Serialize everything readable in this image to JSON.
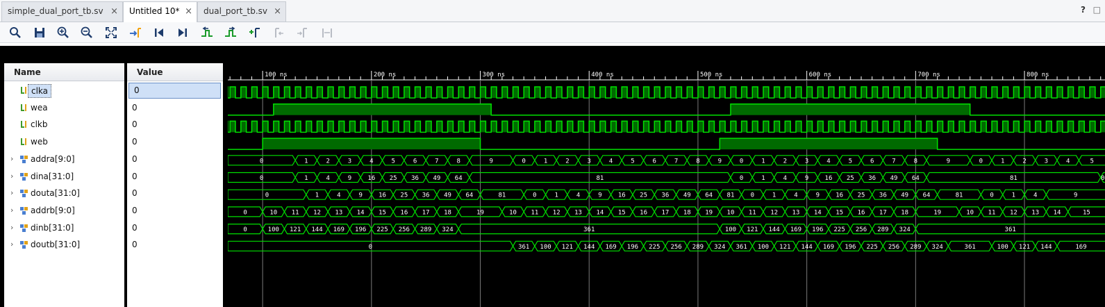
{
  "tabs": [
    {
      "label": "simple_dual_port_tb.sv",
      "close": "×"
    },
    {
      "label": "Untitled 10*",
      "close": "×"
    },
    {
      "label": "dual_port_tb.sv",
      "close": "×"
    }
  ],
  "header_buttons": {
    "help": "?",
    "float": "□"
  },
  "toolbar": {
    "icons": [
      "search-icon",
      "save-icon",
      "zoom-in-icon",
      "zoom-out-icon",
      "zoom-fit-icon",
      "go-to-cursor-icon",
      "go-to-start-icon",
      "go-to-end-icon",
      "previous-transition-icon",
      "next-transition-icon",
      "add-marker-icon",
      "previous-marker-icon",
      "next-marker-icon",
      "swap-cursors-icon"
    ]
  },
  "columns": {
    "name": "Name",
    "value": "Value"
  },
  "colors": {
    "wave": "#00e000",
    "wave_fill": "#006a00",
    "background": "#000000",
    "selection": "#cfe0f7"
  },
  "signals": [
    {
      "name": "clka",
      "value": "0",
      "kind": "bit",
      "expandable": false,
      "selected": true
    },
    {
      "name": "wea",
      "value": "0",
      "kind": "bit",
      "expandable": false,
      "selected": false
    },
    {
      "name": "clkb",
      "value": "0",
      "kind": "bit",
      "expandable": false,
      "selected": false
    },
    {
      "name": "web",
      "value": "0",
      "kind": "bit",
      "expandable": false,
      "selected": false
    },
    {
      "name": "addra[9:0]",
      "value": "0",
      "kind": "bus",
      "expandable": true,
      "selected": false
    },
    {
      "name": "dina[31:0]",
      "value": "0",
      "kind": "bus",
      "expandable": true,
      "selected": false
    },
    {
      "name": "douta[31:0]",
      "value": "0",
      "kind": "bus",
      "expandable": true,
      "selected": false
    },
    {
      "name": "addrb[9:0]",
      "value": "0",
      "kind": "bus",
      "expandable": true,
      "selected": false
    },
    {
      "name": "dinb[31:0]",
      "value": "0",
      "kind": "bus",
      "expandable": true,
      "selected": false
    },
    {
      "name": "doutb[31:0]",
      "value": "0",
      "kind": "bus",
      "expandable": true,
      "selected": false
    }
  ],
  "timeline": {
    "unit": "ns",
    "major_ticks": [
      100,
      200,
      300,
      400,
      500,
      600,
      700,
      800
    ],
    "labels": [
      "100 ns",
      "200 ns",
      "300 ns",
      "400 ns",
      "500 ns",
      "600 ns",
      "700 ns",
      "800 ns"
    ],
    "view_start_ns": 68,
    "view_end_ns": 876,
    "clka_period_ns": 10,
    "clkb_period_ns": 10
  },
  "waves": {
    "wea": [
      [
        68,
        0
      ],
      [
        110,
        1
      ],
      [
        310,
        0
      ],
      [
        530,
        1
      ],
      [
        750,
        0
      ]
    ],
    "web": [
      [
        68,
        0
      ],
      [
        100,
        1
      ],
      [
        300,
        0
      ],
      [
        520,
        1
      ],
      [
        720,
        0
      ]
    ],
    "addra": [
      [
        68,
        "0"
      ],
      [
        130,
        "1"
      ],
      [
        150,
        "2"
      ],
      [
        170,
        "3"
      ],
      [
        190,
        "4"
      ],
      [
        210,
        "5"
      ],
      [
        230,
        "6"
      ],
      [
        250,
        "7"
      ],
      [
        270,
        "8"
      ],
      [
        290,
        "9"
      ],
      [
        330,
        "0"
      ],
      [
        350,
        "1"
      ],
      [
        370,
        "2"
      ],
      [
        390,
        "3"
      ],
      [
        410,
        "4"
      ],
      [
        430,
        "5"
      ],
      [
        450,
        "6"
      ],
      [
        470,
        "7"
      ],
      [
        490,
        "8"
      ],
      [
        510,
        "9"
      ],
      [
        530,
        "0"
      ],
      [
        550,
        "1"
      ],
      [
        570,
        "2"
      ],
      [
        590,
        "3"
      ],
      [
        610,
        "4"
      ],
      [
        630,
        "5"
      ],
      [
        650,
        "6"
      ],
      [
        670,
        "7"
      ],
      [
        690,
        "8"
      ],
      [
        710,
        "9"
      ],
      [
        750,
        "0"
      ],
      [
        770,
        "1"
      ],
      [
        790,
        "2"
      ],
      [
        810,
        "3"
      ],
      [
        830,
        "4"
      ],
      [
        850,
        "5"
      ]
    ],
    "dina": [
      [
        68,
        "0"
      ],
      [
        130,
        "1"
      ],
      [
        150,
        "4"
      ],
      [
        170,
        "9"
      ],
      [
        190,
        "16"
      ],
      [
        210,
        "25"
      ],
      [
        230,
        "36"
      ],
      [
        250,
        "49"
      ],
      [
        270,
        "64"
      ],
      [
        290,
        "81"
      ],
      [
        530,
        "0"
      ],
      [
        550,
        "1"
      ],
      [
        570,
        "4"
      ],
      [
        590,
        "9"
      ],
      [
        610,
        "16"
      ],
      [
        630,
        "25"
      ],
      [
        650,
        "36"
      ],
      [
        670,
        "49"
      ],
      [
        690,
        "64"
      ],
      [
        710,
        "81"
      ],
      [
        870,
        "0"
      ]
    ],
    "douta": [
      [
        68,
        "0"
      ],
      [
        140,
        "1"
      ],
      [
        160,
        "4"
      ],
      [
        180,
        "9"
      ],
      [
        200,
        "16"
      ],
      [
        220,
        "25"
      ],
      [
        240,
        "36"
      ],
      [
        260,
        "49"
      ],
      [
        280,
        "64"
      ],
      [
        300,
        "81"
      ],
      [
        340,
        "0"
      ],
      [
        360,
        "1"
      ],
      [
        380,
        "4"
      ],
      [
        400,
        "9"
      ],
      [
        420,
        "16"
      ],
      [
        440,
        "25"
      ],
      [
        460,
        "36"
      ],
      [
        480,
        "49"
      ],
      [
        500,
        "64"
      ],
      [
        520,
        "81"
      ],
      [
        540,
        "0"
      ],
      [
        560,
        "1"
      ],
      [
        580,
        "4"
      ],
      [
        600,
        "9"
      ],
      [
        620,
        "16"
      ],
      [
        640,
        "25"
      ],
      [
        660,
        "36"
      ],
      [
        680,
        "49"
      ],
      [
        700,
        "64"
      ],
      [
        720,
        "81"
      ],
      [
        760,
        "0"
      ],
      [
        780,
        "1"
      ],
      [
        800,
        "4"
      ],
      [
        820,
        "9"
      ]
    ],
    "addrb": [
      [
        68,
        "0"
      ],
      [
        100,
        "10"
      ],
      [
        120,
        "11"
      ],
      [
        140,
        "12"
      ],
      [
        160,
        "13"
      ],
      [
        180,
        "14"
      ],
      [
        200,
        "15"
      ],
      [
        220,
        "16"
      ],
      [
        240,
        "17"
      ],
      [
        260,
        "18"
      ],
      [
        280,
        "19"
      ],
      [
        320,
        "10"
      ],
      [
        340,
        "11"
      ],
      [
        360,
        "12"
      ],
      [
        380,
        "13"
      ],
      [
        400,
        "14"
      ],
      [
        420,
        "15"
      ],
      [
        440,
        "16"
      ],
      [
        460,
        "17"
      ],
      [
        480,
        "18"
      ],
      [
        500,
        "19"
      ],
      [
        520,
        "10"
      ],
      [
        540,
        "11"
      ],
      [
        560,
        "12"
      ],
      [
        580,
        "13"
      ],
      [
        600,
        "14"
      ],
      [
        620,
        "15"
      ],
      [
        640,
        "16"
      ],
      [
        660,
        "17"
      ],
      [
        680,
        "18"
      ],
      [
        700,
        "19"
      ],
      [
        740,
        "10"
      ],
      [
        760,
        "11"
      ],
      [
        780,
        "12"
      ],
      [
        800,
        "13"
      ],
      [
        820,
        "14"
      ],
      [
        840,
        "15"
      ]
    ],
    "dinb": [
      [
        68,
        "0"
      ],
      [
        100,
        "100"
      ],
      [
        120,
        "121"
      ],
      [
        140,
        "144"
      ],
      [
        160,
        "169"
      ],
      [
        180,
        "196"
      ],
      [
        200,
        "225"
      ],
      [
        220,
        "256"
      ],
      [
        240,
        "289"
      ],
      [
        260,
        "324"
      ],
      [
        280,
        "361"
      ],
      [
        520,
        "100"
      ],
      [
        540,
        "121"
      ],
      [
        560,
        "144"
      ],
      [
        580,
        "169"
      ],
      [
        600,
        "196"
      ],
      [
        620,
        "225"
      ],
      [
        640,
        "256"
      ],
      [
        660,
        "289"
      ],
      [
        680,
        "324"
      ],
      [
        700,
        "361"
      ]
    ],
    "doutb": [
      [
        68,
        "0"
      ],
      [
        330,
        "361"
      ],
      [
        350,
        "100"
      ],
      [
        370,
        "121"
      ],
      [
        390,
        "144"
      ],
      [
        410,
        "169"
      ],
      [
        430,
        "196"
      ],
      [
        450,
        "225"
      ],
      [
        470,
        "256"
      ],
      [
        490,
        "289"
      ],
      [
        510,
        "324"
      ],
      [
        530,
        "361"
      ],
      [
        550,
        "100"
      ],
      [
        570,
        "121"
      ],
      [
        590,
        "144"
      ],
      [
        610,
        "169"
      ],
      [
        630,
        "196"
      ],
      [
        650,
        "225"
      ],
      [
        670,
        "256"
      ],
      [
        690,
        "289"
      ],
      [
        710,
        "324"
      ],
      [
        730,
        "361"
      ],
      [
        770,
        "100"
      ],
      [
        790,
        "121"
      ],
      [
        810,
        "144"
      ],
      [
        830,
        "169"
      ]
    ]
  }
}
